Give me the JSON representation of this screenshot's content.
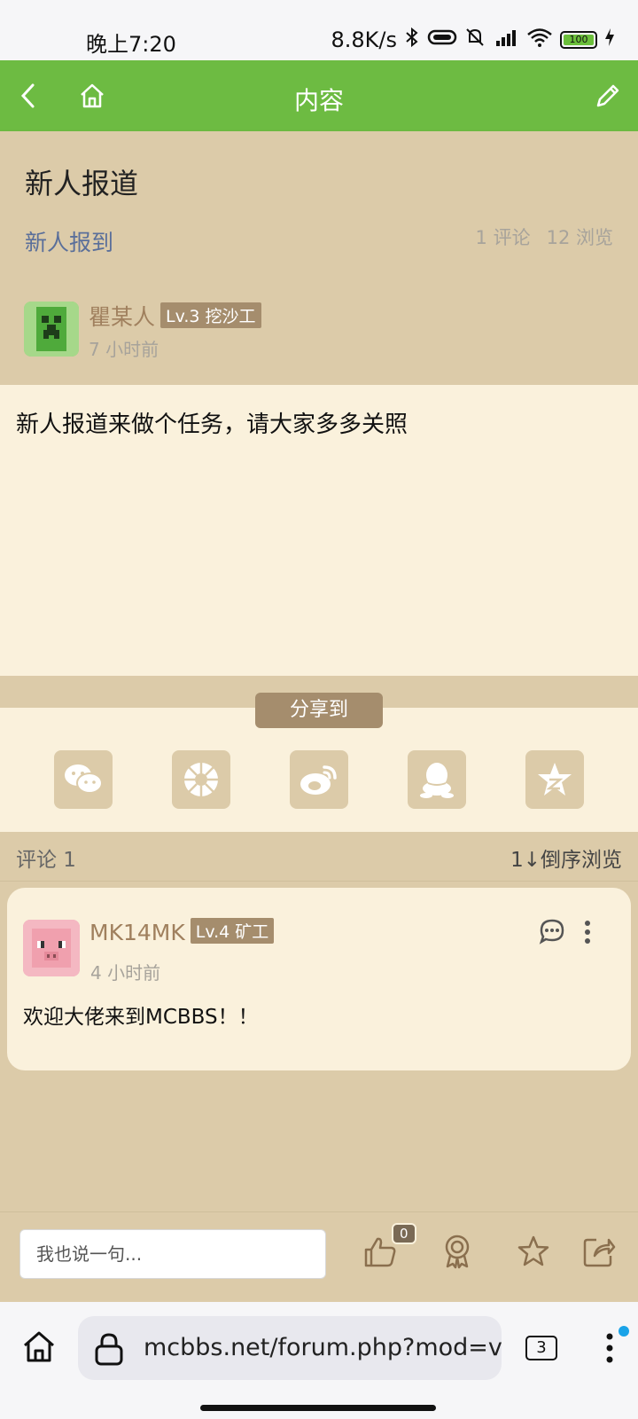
{
  "status_bar": {
    "time": "晚上7:20",
    "speed": "8.8K/s",
    "battery": "100"
  },
  "header": {
    "title": "内容"
  },
  "post": {
    "title": "新人报道",
    "forum": "新人报到",
    "comments": "1 评论",
    "views": "12 浏览",
    "author": {
      "name": "瞿某人",
      "level": "Lv.3 挖沙工",
      "time": "7 小时前"
    },
    "content": "新人报道来做个任务，请大家多多关照"
  },
  "share": {
    "label": "分享到",
    "targets": [
      "wechat-icon",
      "moments-icon",
      "weibo-icon",
      "qq-icon",
      "qzone-icon"
    ]
  },
  "comments_section": {
    "count_label": "评论 1",
    "sort_label": "倒序浏览",
    "sort_icon": "1↓"
  },
  "comment": {
    "author": "MK14MK",
    "level": "Lv.4 矿工",
    "time": "4 小时前",
    "text": "欢迎大佬来到MCBBS！！"
  },
  "reply_bar": {
    "placeholder": "我也说一句...",
    "like_count": "0"
  },
  "browser": {
    "url": "mcbbs.net/forum.php?mod=viev",
    "tab_count": "3"
  },
  "colors": {
    "header_green": "#6dbb42",
    "beige": "#dccba9",
    "cream": "#faf1dc",
    "badge_brown": "#a58d6d"
  }
}
